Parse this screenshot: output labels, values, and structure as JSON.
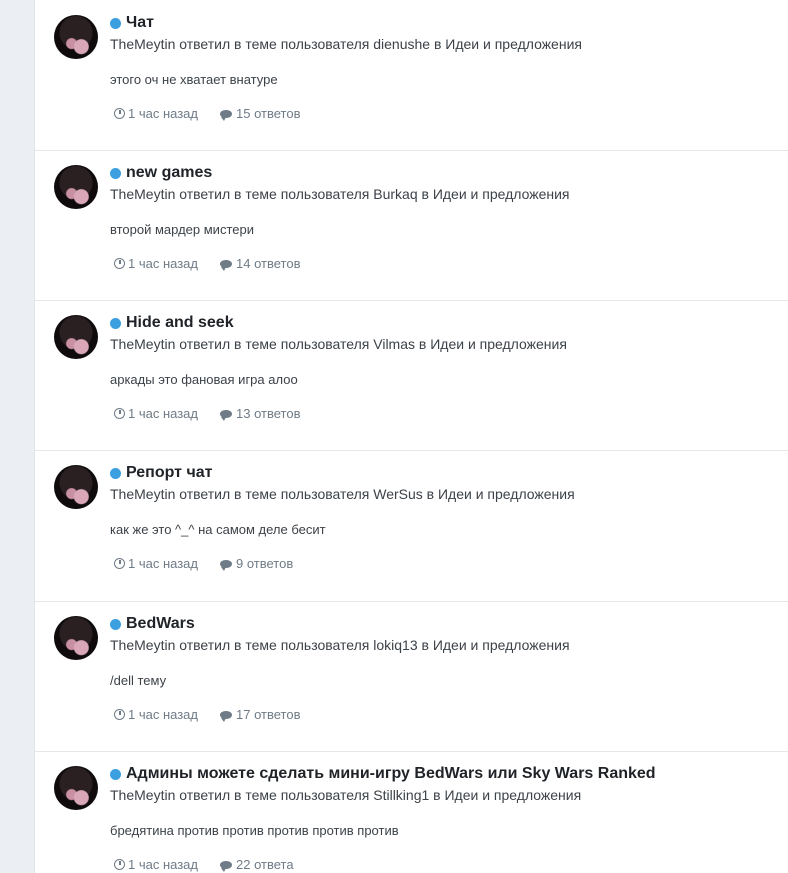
{
  "activity": [
    {
      "title": "Чат",
      "meta": "TheMeytin ответил в теме пользователя dienushe в Идеи и предложения",
      "excerpt": "этого оч не хватает внатуре",
      "time": "1 час назад",
      "replies": "15 ответов"
    },
    {
      "title": "new games",
      "meta": "TheMeytin ответил в теме пользователя Burkaq в Идеи и предложения",
      "excerpt": "второй мардер мистери",
      "time": "1 час назад",
      "replies": "14 ответов"
    },
    {
      "title": "Hide and seek",
      "meta": "TheMeytin ответил в теме пользователя Vilmas в Идеи и предложения",
      "excerpt": "аркады это фановая игра алоо",
      "time": "1 час назад",
      "replies": "13 ответов"
    },
    {
      "title": "Репорт чат",
      "meta": "TheMeytin ответил в теме пользователя WerSus в Идеи и предложения",
      "excerpt": "как же это ^_^ на самом деле бесит",
      "time": "1 час назад",
      "replies": "9 ответов"
    },
    {
      "title": "BedWars",
      "meta": "TheMeytin ответил в теме пользователя lokiq13 в Идеи и предложения",
      "excerpt": "/dell тему",
      "time": "1 час назад",
      "replies": "17 ответов"
    },
    {
      "title": "Админы можете сделать мини-игру BedWars или Sky Wars Ranked",
      "meta": "TheMeytin ответил в теме пользователя Stillking1 в Идеи и предложения",
      "excerpt": "бредятина против против против против против",
      "time": "1 час назад",
      "replies": "22 ответа"
    }
  ],
  "icons": {
    "unread": "dot-icon",
    "time": "clock-icon",
    "replies": "comment-icon"
  },
  "colors": {
    "unread_dot": "#3c9fe0",
    "background": "#ebeef2",
    "muted": "#6f7b86"
  }
}
